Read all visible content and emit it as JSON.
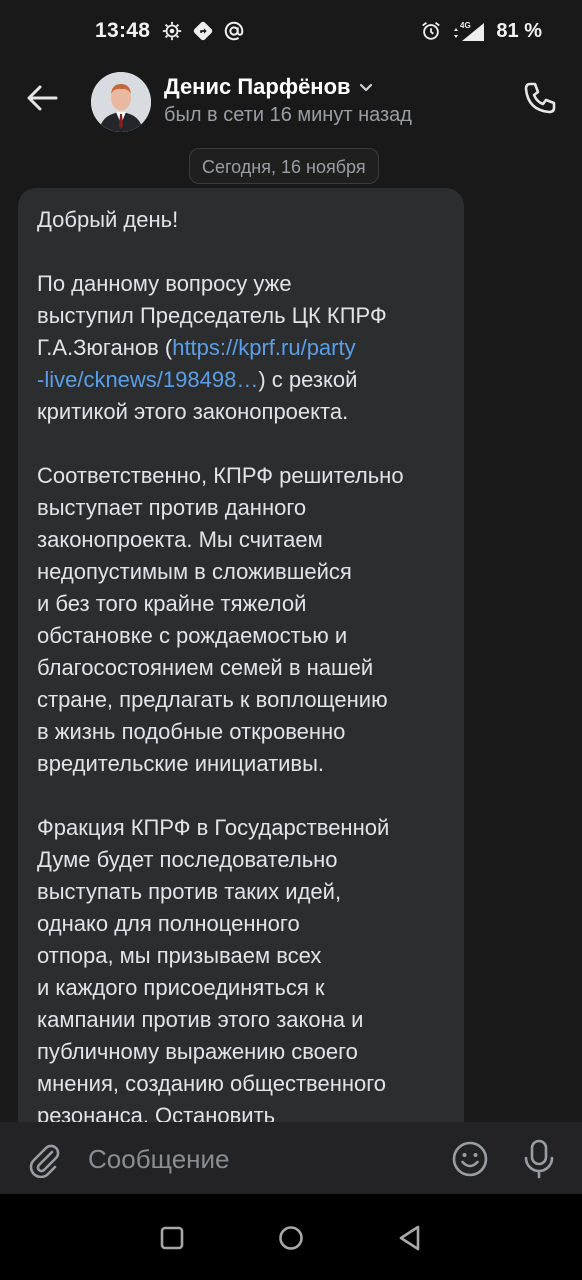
{
  "status_bar": {
    "time": "13:48",
    "battery": "81 %",
    "network_badge": "4G",
    "icons_left": [
      "cpu-icon",
      "directions-icon",
      "at-icon"
    ],
    "icons_right": [
      "alarm-icon",
      "signal-icon"
    ]
  },
  "header": {
    "back_icon": "arrow-left-icon",
    "contact_name": "Денис Парфёнов",
    "last_seen": "был в сети 16 минут назад",
    "call_icon": "phone-icon"
  },
  "date_separator": "Сегодня, 16 ноября",
  "message": {
    "p1": "Добрый день!",
    "p2_before": "По данному вопросу уже\nвыступил Председатель ЦК КПРФ\nГ.А.Зюганов (",
    "p2_link": "https://kprf.ru/party\n-live/cknews/198498…",
    "p2_after": ") с резкой\nкритикой этого законопроекта.",
    "p3": "Соответственно, КПРФ решительно\nвыступает против данного\nзаконопроекта. Мы считаем\nнедопустимым в сложившейся\nи без того крайне тяжелой\nобстановке с рождаемостью и\nблагосостоянием семей в нашей\nстране, предлагать к воплощению\nв жизнь подобные откровенно\nвредительские инициативы.",
    "p4": "Фракция КПРФ в Государственной\nДуме будет последовательно\nвыступать против таких идей,\nоднако для полноценного\nотпора, мы призываем всех\nи каждого присоединяться к\nкампании против этого закона и\nпубличному выражению своего\nмнения, созданию общественного\nрезонанса. Остановить"
  },
  "composer": {
    "placeholder": "Сообщение",
    "attach_icon": "paperclip-icon",
    "emoji_icon": "smile-icon",
    "mic_icon": "microphone-icon"
  },
  "colors": {
    "background": "#19191a",
    "bubble": "#2c2d2f",
    "link": "#5b9ee8",
    "composer": "#232325"
  }
}
